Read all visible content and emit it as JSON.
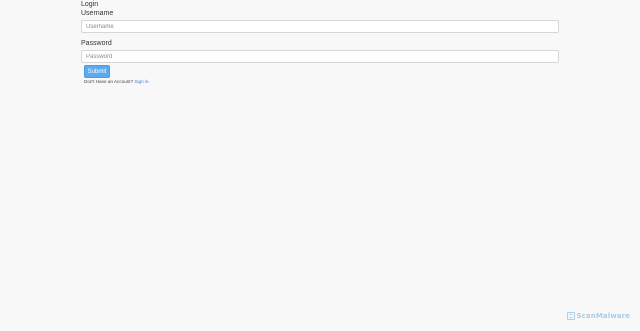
{
  "form": {
    "title": "Login",
    "username_label": "Username",
    "username_placeholder": "Username",
    "username_value": "",
    "password_label": "Password",
    "password_placeholder": "Password",
    "password_value": "",
    "submit_label": "Submit",
    "signup_prompt": "Don't Have an Account?",
    "signup_link_label": "Sign in."
  },
  "watermark": {
    "icon": "scanmalware-logo-icon",
    "text": "ScanMalware"
  },
  "colors": {
    "background": "#f8f8f8",
    "submit_button": "#5aaaf0",
    "link": "#3a7fd5",
    "watermark": "#6aa8d8"
  }
}
